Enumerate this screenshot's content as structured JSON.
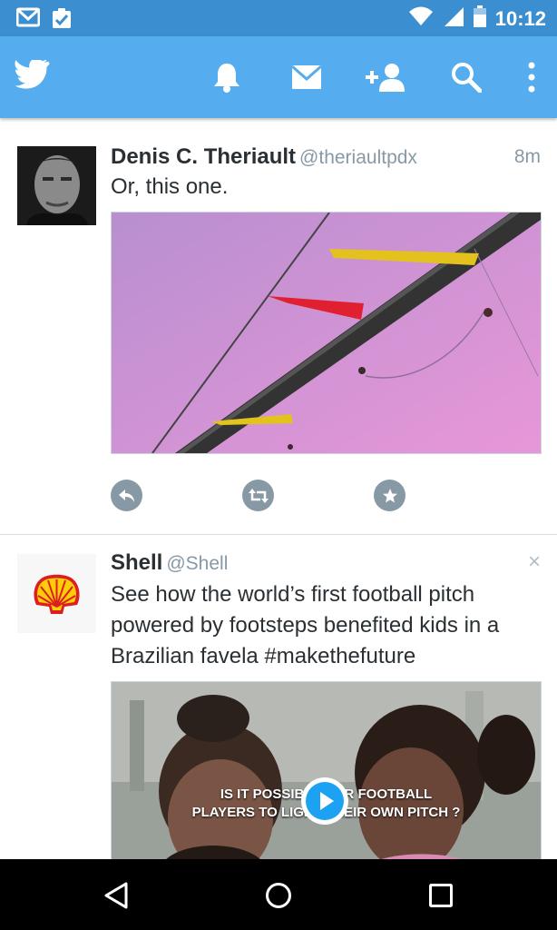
{
  "status_bar": {
    "time": "10:12",
    "left_icons": [
      "gmail-icon",
      "clipboard-check-icon"
    ],
    "right_icons": [
      "wifi-icon",
      "cell-signal-icon",
      "battery-icon"
    ]
  },
  "app_bar": {
    "logo": "twitter-bird-icon",
    "actions": [
      "notifications-bell-icon",
      "messages-envelope-icon",
      "add-user-icon",
      "search-icon",
      "overflow-menu-icon"
    ],
    "colors": {
      "bar": "#55acee",
      "status": "#3b8fd0"
    }
  },
  "tweets": [
    {
      "name": "Denis C. Theriault",
      "handle": "@theriaultpdx",
      "time": "8m",
      "text": "Or, this one.",
      "media": "photo",
      "actions": [
        "reply-icon",
        "retweet-icon",
        "favorite-star-icon"
      ]
    },
    {
      "name": "Shell",
      "handle": "@Shell",
      "text": "See how the world’s first football pitch powered by footsteps benefited kids in a Brazilian favela #makethefuture",
      "media": "video",
      "video_caption_line1": "IS IT POSSIBLE FOR FOOTBALL",
      "video_caption_line2": "PLAYERS TO LIGHT THEIR OWN PITCH ?",
      "dismiss": "×"
    }
  ],
  "nav_bar": {
    "icons": [
      "back-icon",
      "home-icon",
      "recents-icon"
    ]
  }
}
